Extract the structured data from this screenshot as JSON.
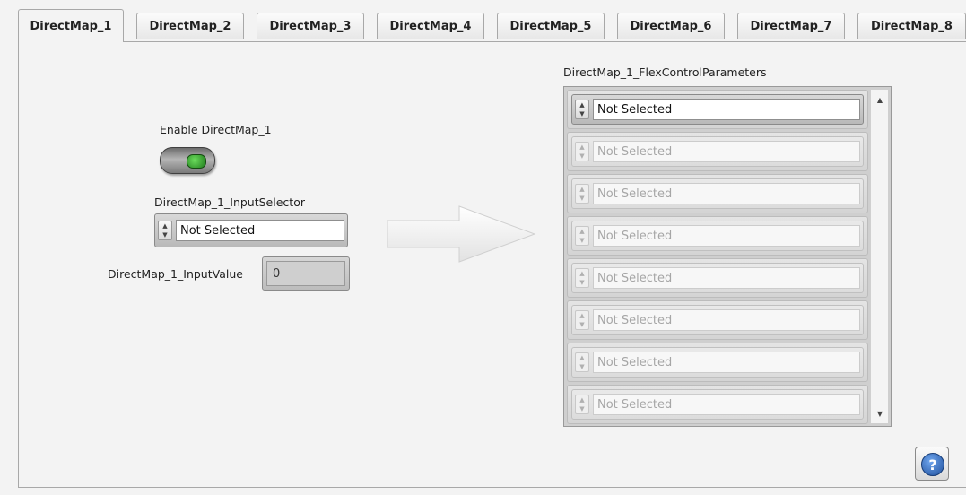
{
  "tabs": [
    {
      "label": "DirectMap_1",
      "active": true
    },
    {
      "label": "DirectMap_2",
      "active": false
    },
    {
      "label": "DirectMap_3",
      "active": false
    },
    {
      "label": "DirectMap_4",
      "active": false
    },
    {
      "label": "DirectMap_5",
      "active": false
    },
    {
      "label": "DirectMap_6",
      "active": false
    },
    {
      "label": "DirectMap_7",
      "active": false
    },
    {
      "label": "DirectMap_8",
      "active": false
    }
  ],
  "left": {
    "enable_label": "Enable DirectMap_1",
    "enable_state": true,
    "selector_label": "DirectMap_1_InputSelector",
    "selector_value": "Not Selected",
    "input_value_label": "DirectMap_1_InputValue",
    "input_value": "0"
  },
  "right": {
    "array_label": "DirectMap_1_FlexControlParameters",
    "items": [
      {
        "value": "Not Selected",
        "enabled": true
      },
      {
        "value": "Not Selected",
        "enabled": false
      },
      {
        "value": "Not Selected",
        "enabled": false
      },
      {
        "value": "Not Selected",
        "enabled": false
      },
      {
        "value": "Not Selected",
        "enabled": false
      },
      {
        "value": "Not Selected",
        "enabled": false
      },
      {
        "value": "Not Selected",
        "enabled": false
      },
      {
        "value": "Not Selected",
        "enabled": false
      }
    ]
  },
  "icons": {
    "toggle": "toggle-switch-icon",
    "arrow": "right-arrow-icon",
    "help": "help-icon",
    "spin": "spin-arrows-icon"
  },
  "colors": {
    "toggle_led": "#3fb43a",
    "help_blue": "#2f68c0"
  }
}
